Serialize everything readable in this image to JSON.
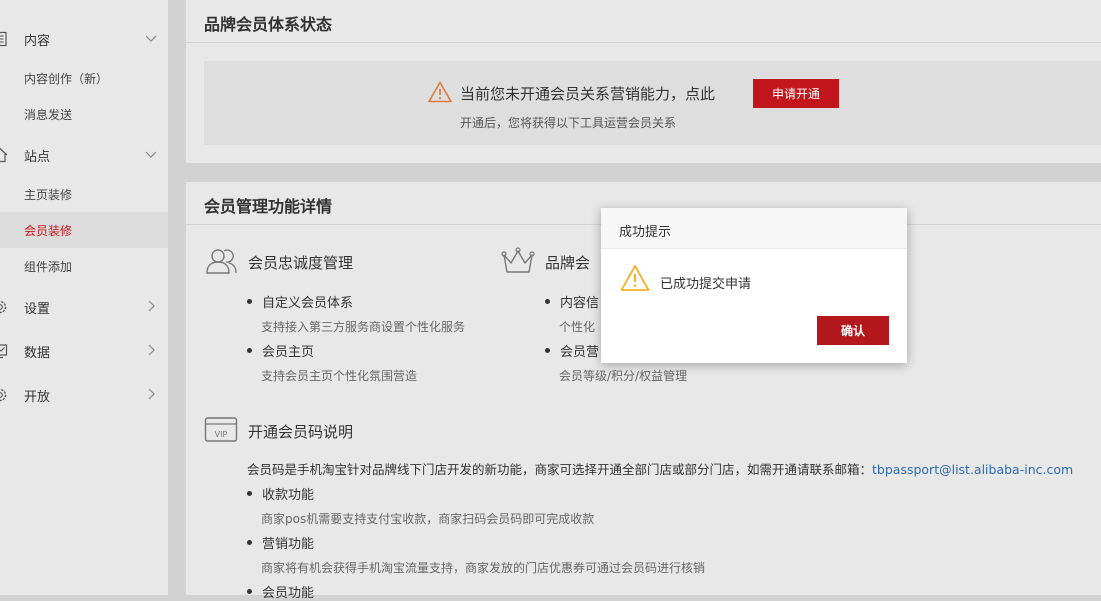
{
  "sidebar": {
    "content_group": "内容",
    "content_create": "内容创作（新）",
    "message_send": "消息发送",
    "site_group": "站点",
    "home_decor": "主页装修",
    "member_decor": "会员装修",
    "widget_add": "组件添加",
    "settings_group": "设置",
    "data_group": "数据",
    "open_group": "开放"
  },
  "status_panel": {
    "title": "品牌会员体系状态",
    "notice": "当前您未开通会员关系营销能力，点此",
    "apply_button": "申请开通",
    "subtext": "开通后，您将获得以下工具运营会员关系"
  },
  "detail_panel": {
    "title": "会员管理功能详情",
    "loyalty": {
      "title": "会员忠诚度管理",
      "items": [
        {
          "label": "自定义会员体系",
          "desc": "支持接入第三方服务商设置个性化服务"
        },
        {
          "label": "会员主页",
          "desc": "支持会员主页个性化氛围营造"
        }
      ]
    },
    "brand": {
      "title": "品牌会",
      "items": [
        {
          "label": "内容信",
          "desc": "个性化"
        },
        {
          "label": "会员营",
          "desc": "会员等级/积分/权益管理"
        }
      ]
    },
    "vip": {
      "title": "开通会员码说明",
      "intro": "会员码是手机淘宝针对品牌线下门店开发的新功能，商家可选择开通全部门店或部分门店，如需开通请联系邮箱：",
      "email": "tbpassport@list.alibaba-inc.com",
      "items": [
        {
          "label": "收款功能",
          "desc": "商家pos机需要支持支付宝收款，商家扫码会员码即可完成收款"
        },
        {
          "label": "营销功能",
          "desc": "商家将有机会获得手机淘宝流量支持，商家发放的门店优惠券可通过会员码进行核销"
        },
        {
          "label": "会员功能"
        }
      ]
    }
  },
  "modal": {
    "title": "成功提示",
    "message": "已成功提交申请",
    "confirm": "确认"
  },
  "colors": {
    "accent_red": "#c3161c",
    "warning_orange": "#e07b39",
    "warning_yellow": "#f0b429",
    "link_blue": "#2b6cb5"
  }
}
